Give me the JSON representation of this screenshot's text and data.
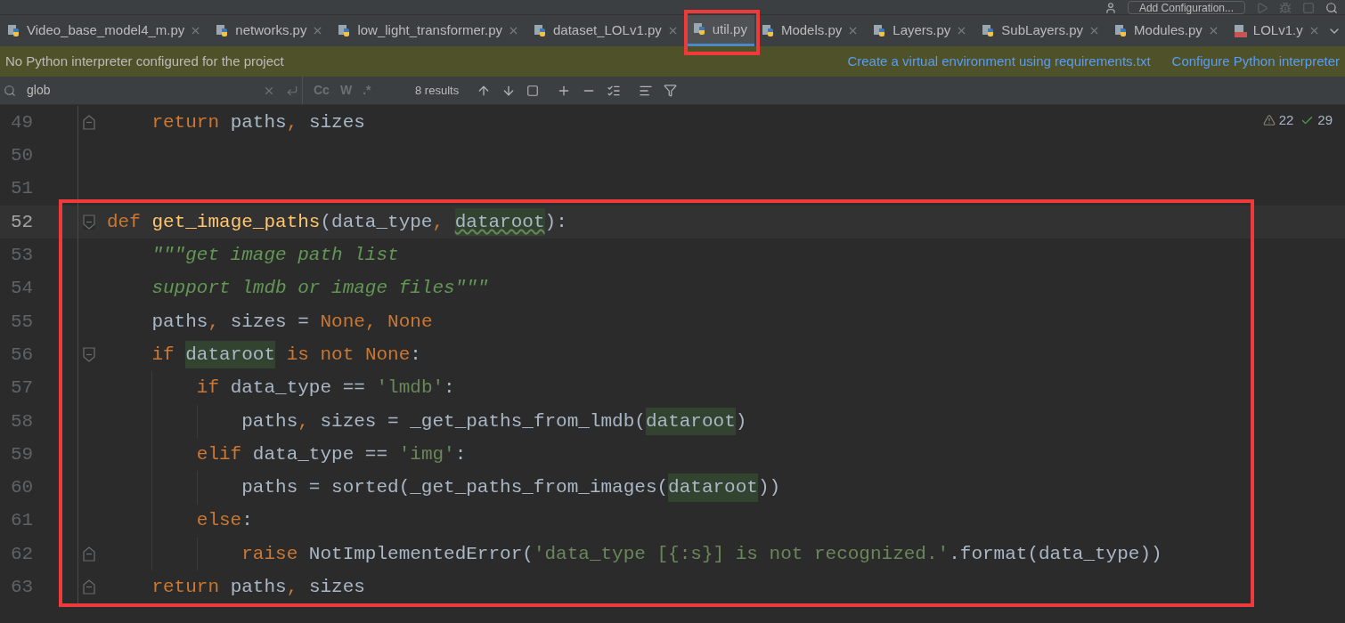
{
  "toolbar": {
    "config_button": "Add Configuration..."
  },
  "tabs": [
    {
      "label": "Video_base_model4_m.py",
      "kind": "python",
      "selected": false,
      "boxed": false
    },
    {
      "label": "networks.py",
      "kind": "python",
      "selected": false,
      "boxed": false
    },
    {
      "label": "low_light_transformer.py",
      "kind": "python",
      "selected": false,
      "boxed": false
    },
    {
      "label": "dataset_LOLv1.py",
      "kind": "python",
      "selected": false,
      "boxed": false
    },
    {
      "label": "util.py",
      "kind": "python",
      "selected": true,
      "boxed": true
    },
    {
      "label": "Models.py",
      "kind": "python",
      "selected": false,
      "boxed": false
    },
    {
      "label": "Layers.py",
      "kind": "python",
      "selected": false,
      "boxed": false
    },
    {
      "label": "SubLayers.py",
      "kind": "python",
      "selected": false,
      "boxed": false
    },
    {
      "label": "Modules.py",
      "kind": "python",
      "selected": false,
      "boxed": false
    },
    {
      "label": "LOLv1.y",
      "kind": "yaml",
      "selected": false,
      "boxed": false
    }
  ],
  "notification": {
    "message": "No Python interpreter configured for the project",
    "links": [
      "Create a virtual environment using requirements.txt",
      "Configure Python interpreter"
    ]
  },
  "search": {
    "value": "glob",
    "toggles": [
      "Cc",
      "W",
      ".*"
    ],
    "results": "8 results"
  },
  "inspections": {
    "warnings": "22",
    "typos": "29"
  },
  "editor": {
    "lines": [
      {
        "number": "49",
        "fold_start": false,
        "fold_end": true,
        "current": false,
        "boxed": false,
        "tokens": [
          {
            "text": "    return",
            "kind": "keyword"
          },
          {
            "text": " paths",
            "kind": "plain"
          },
          {
            "text": ",",
            "kind": "keyword"
          },
          {
            "text": " sizes",
            "kind": "plain"
          }
        ]
      },
      {
        "number": "50",
        "fold_start": false,
        "fold_end": false,
        "current": false,
        "boxed": false
      },
      {
        "number": "51",
        "fold_start": false,
        "fold_end": false,
        "current": false,
        "boxed": false
      },
      {
        "number": "52",
        "fold_start": true,
        "fold_end": false,
        "current": true,
        "boxed": true,
        "tokens": [
          {
            "text": "def",
            "kind": "keyword"
          },
          {
            "text": " get_image_paths",
            "kind": "function"
          },
          {
            "text": "(data_type",
            "kind": "plain"
          },
          {
            "text": ",",
            "kind": "keyword"
          },
          {
            "text": " dataroot",
            "kind": "warned"
          },
          {
            "text": "):",
            "kind": "plain"
          }
        ]
      },
      {
        "number": "53",
        "fold_start": false,
        "fold_end": false,
        "current": false,
        "boxed": true,
        "tokens": [
          {
            "text": "    \"\"\"get image path list",
            "kind": "docstring"
          }
        ]
      },
      {
        "number": "54",
        "fold_start": false,
        "fold_end": false,
        "current": false,
        "boxed": true,
        "tokens": [
          {
            "text": "    support lmdb or image files\"\"\"",
            "kind": "docstring"
          }
        ]
      },
      {
        "number": "55",
        "fold_start": false,
        "fold_end": false,
        "current": false,
        "boxed": true,
        "tokens": [
          {
            "text": "    paths",
            "kind": "plain"
          },
          {
            "text": ",",
            "kind": "keyword"
          },
          {
            "text": " sizes = ",
            "kind": "plain"
          },
          {
            "text": "None",
            "kind": "keyword"
          },
          {
            "text": ", None",
            "kind": "keyword"
          }
        ]
      },
      {
        "number": "56",
        "fold_start": true,
        "fold_end": false,
        "current": false,
        "boxed": true,
        "tokens": [
          {
            "text": "    if",
            "kind": "keyword"
          },
          {
            "text": " dataroot",
            "kind": "match"
          },
          {
            "text": " is not None",
            "kind": "keyword"
          },
          {
            "text": ":",
            "kind": "plain"
          }
        ]
      },
      {
        "number": "57",
        "fold_start": false,
        "fold_end": false,
        "current": false,
        "boxed": true,
        "tokens": [
          {
            "text": "        if",
            "kind": "keyword"
          },
          {
            "text": " data_type == ",
            "kind": "plain"
          },
          {
            "text": "'lmdb'",
            "kind": "string"
          },
          {
            "text": ":",
            "kind": "plain"
          }
        ]
      },
      {
        "number": "58",
        "fold_start": false,
        "fold_end": false,
        "current": false,
        "boxed": true,
        "tokens": [
          {
            "text": "            paths",
            "kind": "plain"
          },
          {
            "text": ",",
            "kind": "keyword"
          },
          {
            "text": " sizes = _get_paths_from_lmdb(",
            "kind": "plain"
          },
          {
            "text": "dataroot",
            "kind": "match"
          },
          {
            "text": ")",
            "kind": "plain"
          }
        ]
      },
      {
        "number": "59",
        "fold_start": false,
        "fold_end": false,
        "current": false,
        "boxed": true,
        "tokens": [
          {
            "text": "        elif",
            "kind": "keyword"
          },
          {
            "text": " data_type == ",
            "kind": "plain"
          },
          {
            "text": "'img'",
            "kind": "string"
          },
          {
            "text": ":",
            "kind": "plain"
          }
        ]
      },
      {
        "number": "60",
        "fold_start": false,
        "fold_end": false,
        "current": false,
        "boxed": true,
        "tokens": [
          {
            "text": "            paths = sorted(_get_paths_from_images(",
            "kind": "plain"
          },
          {
            "text": "dataroot",
            "kind": "match"
          },
          {
            "text": "))",
            "kind": "plain"
          }
        ]
      },
      {
        "number": "61",
        "fold_start": false,
        "fold_end": false,
        "current": false,
        "boxed": true,
        "tokens": [
          {
            "text": "        else",
            "kind": "keyword"
          },
          {
            "text": ":",
            "kind": "plain"
          }
        ]
      },
      {
        "number": "62",
        "fold_start": false,
        "fold_end": true,
        "current": false,
        "boxed": true,
        "tokens": [
          {
            "text": "            raise",
            "kind": "keyword"
          },
          {
            "text": " NotImplementedError(",
            "kind": "plain"
          },
          {
            "text": "'data_type [{:s}] is not recognized.'",
            "kind": "string"
          },
          {
            "text": ".format(data_type))",
            "kind": "plain"
          }
        ]
      },
      {
        "number": "63",
        "fold_start": false,
        "fold_end": true,
        "current": false,
        "boxed": true,
        "tokens": [
          {
            "text": "    return",
            "kind": "keyword"
          },
          {
            "text": " paths",
            "kind": "plain"
          },
          {
            "text": ",",
            "kind": "keyword"
          },
          {
            "text": " sizes",
            "kind": "plain"
          }
        ]
      }
    ]
  }
}
